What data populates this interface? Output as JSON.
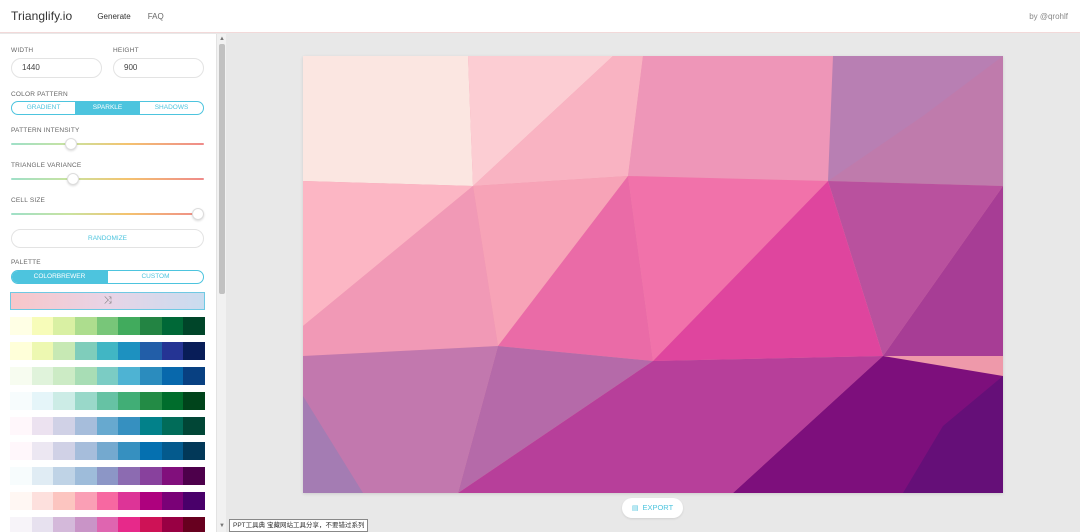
{
  "app": {
    "logo": "Trianglify.io",
    "byline": "by @qrohlf"
  },
  "nav": [
    {
      "label": "Generate",
      "active": true
    },
    {
      "label": "FAQ",
      "active": false
    }
  ],
  "sidebar": {
    "width_label": "WIDTH",
    "width_value": "1440",
    "height_label": "HEIGHT",
    "height_value": "900",
    "color_pattern_label": "COLOR PATTERN",
    "color_pattern_options": [
      "GRADIENT",
      "SPARKLE",
      "SHADOWS"
    ],
    "color_pattern_selected": "SPARKLE",
    "pattern_intensity_label": "PATTERN INTENSITY",
    "pattern_intensity_level": 0.31,
    "triangle_variance_label": "TRIANGLE VARIANCE",
    "triangle_variance_level": 0.32,
    "cell_size_label": "CELL SIZE",
    "cell_size_level": 0.97,
    "randomize_label": "RANDOMIZE",
    "palette_label": "PALETTE",
    "palette_options": [
      "COLORBREWER",
      "CUSTOM"
    ],
    "palette_selected": "COLORBREWER",
    "palette_preview_icon": "shuffle-icon",
    "palettes": [
      [
        "#ffffe5",
        "#f7fcb9",
        "#d9f0a3",
        "#addd8e",
        "#78c679",
        "#41ab5d",
        "#238443",
        "#006837",
        "#004529"
      ],
      [
        "#ffffd9",
        "#edf8b1",
        "#c7e9b4",
        "#7fcdbb",
        "#41b6c4",
        "#1d91c0",
        "#225ea8",
        "#253494",
        "#081d58"
      ],
      [
        "#f7fcf0",
        "#e0f3db",
        "#ccebc5",
        "#a8ddb5",
        "#7bccc4",
        "#4eb3d3",
        "#2b8cbe",
        "#0868ac",
        "#084081"
      ],
      [
        "#f7fcfd",
        "#e5f5f9",
        "#ccece6",
        "#99d8c9",
        "#66c2a4",
        "#41ae76",
        "#238b45",
        "#006d2c",
        "#00441b"
      ],
      [
        "#fff7fb",
        "#ece2f0",
        "#d0d1e6",
        "#a6bddb",
        "#67a9cf",
        "#3690c0",
        "#02818a",
        "#016c59",
        "#014636"
      ],
      [
        "#fff7fb",
        "#ece7f2",
        "#d0d1e6",
        "#a6bddb",
        "#74a9cf",
        "#3690c0",
        "#0570b0",
        "#045a8d",
        "#023858"
      ],
      [
        "#f7fcfd",
        "#e0ecf4",
        "#bfd3e6",
        "#9ebcda",
        "#8c96c6",
        "#8c6bb1",
        "#88419d",
        "#810f7c",
        "#4d004b"
      ],
      [
        "#fff7f3",
        "#fde0dd",
        "#fcc5c0",
        "#fa9fb5",
        "#f768a1",
        "#dd3497",
        "#ae017e",
        "#7a0177",
        "#49006a"
      ],
      [
        "#f7f4f9",
        "#e7e1ef",
        "#d4b9da",
        "#c994c7",
        "#df65b0",
        "#e7298a",
        "#ce1256",
        "#980043",
        "#67001f"
      ]
    ]
  },
  "main": {
    "export_label": "EXPORT",
    "export_icon": "export-icon",
    "tooltip": "PPT工具典 宝藏网站工具分享，不要错过系列"
  },
  "canvas_art": {
    "description_colors": [
      "#fbe6e1",
      "#fcc8cf",
      "#f7b8c2",
      "#e990b8",
      "#b683b5",
      "#f59db3",
      "#f36ea8",
      "#d73f98",
      "#c34a9b",
      "#a74aa0",
      "#b3268f",
      "#7e0f7d",
      "#6a0d7a"
    ]
  }
}
